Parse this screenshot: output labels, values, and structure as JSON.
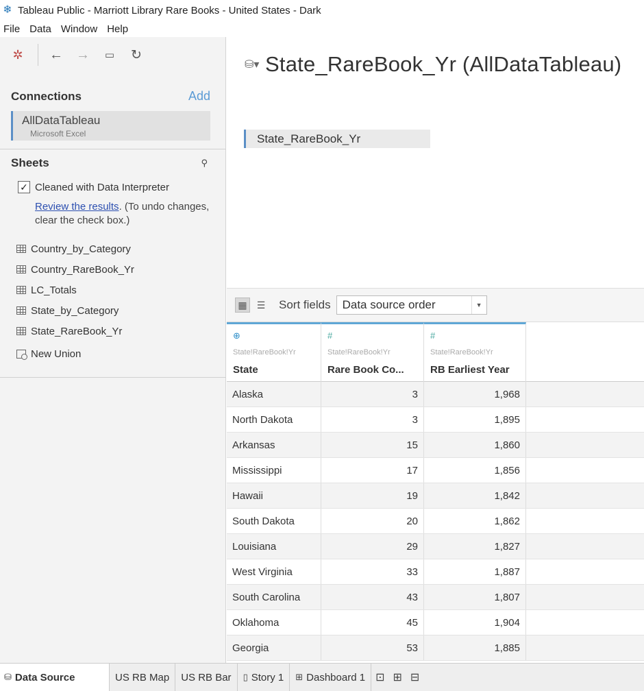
{
  "window": {
    "title": "Tableau Public - Marriott Library Rare Books - United States - Dark"
  },
  "menu": [
    "File",
    "Data",
    "Window",
    "Help"
  ],
  "toolbar": {
    "logo_icon": "tableau-logo-icon",
    "back_icon": "back-arrow-icon",
    "forward_icon": "forward-arrow-icon",
    "save_icon": "save-icon",
    "refresh_icon": "refresh-icon"
  },
  "connections": {
    "title": "Connections",
    "add_label": "Add",
    "items": [
      {
        "name": "AllDataTableau",
        "type": "Microsoft Excel"
      }
    ]
  },
  "sheets": {
    "title": "Sheets",
    "interpreter_label": "Cleaned with Data Interpreter",
    "interpreter_checked": true,
    "review_link": "Review the results",
    "review_note": ". (To undo changes, clear the check box.)",
    "items": [
      "Country_by_Category",
      "Country_RareBook_Yr",
      "LC_Totals",
      "State_by_Category",
      "State_RareBook_Yr"
    ],
    "new_union": "New Union"
  },
  "datasource": {
    "title": "State_RareBook_Yr (AllDataTableau)",
    "table": "State_RareBook_Yr"
  },
  "grid_toolbar": {
    "sort_label": "Sort fields",
    "sort_value": "Data source order"
  },
  "columns": [
    {
      "type_icon": "globe-icon",
      "source": "State!RareBook!Yr",
      "name": "State"
    },
    {
      "type_icon": "number-icon",
      "source": "State!RareBook!Yr",
      "name": "Rare Book Co..."
    },
    {
      "type_icon": "number-icon",
      "source": "State!RareBook!Yr",
      "name": "RB Earliest Year"
    }
  ],
  "rows": [
    [
      "Alaska",
      "3",
      "1,968"
    ],
    [
      "North Dakota",
      "3",
      "1,895"
    ],
    [
      "Arkansas",
      "15",
      "1,860"
    ],
    [
      "Mississippi",
      "17",
      "1,856"
    ],
    [
      "Hawaii",
      "19",
      "1,842"
    ],
    [
      "South Dakota",
      "20",
      "1,862"
    ],
    [
      "Louisiana",
      "29",
      "1,827"
    ],
    [
      "West Virginia",
      "33",
      "1,887"
    ],
    [
      "South Carolina",
      "43",
      "1,807"
    ],
    [
      "Oklahoma",
      "45",
      "1,904"
    ],
    [
      "Georgia",
      "53",
      "1,885"
    ]
  ],
  "tabs": {
    "data_source": "Data Source",
    "items": [
      "US RB Map",
      "US RB Bar",
      "Story 1",
      "Dashboard 1"
    ],
    "new_sheet_icon": "new-worksheet-icon",
    "new_dashboard_icon": "new-dashboard-icon",
    "new_story_icon": "new-story-icon"
  }
}
